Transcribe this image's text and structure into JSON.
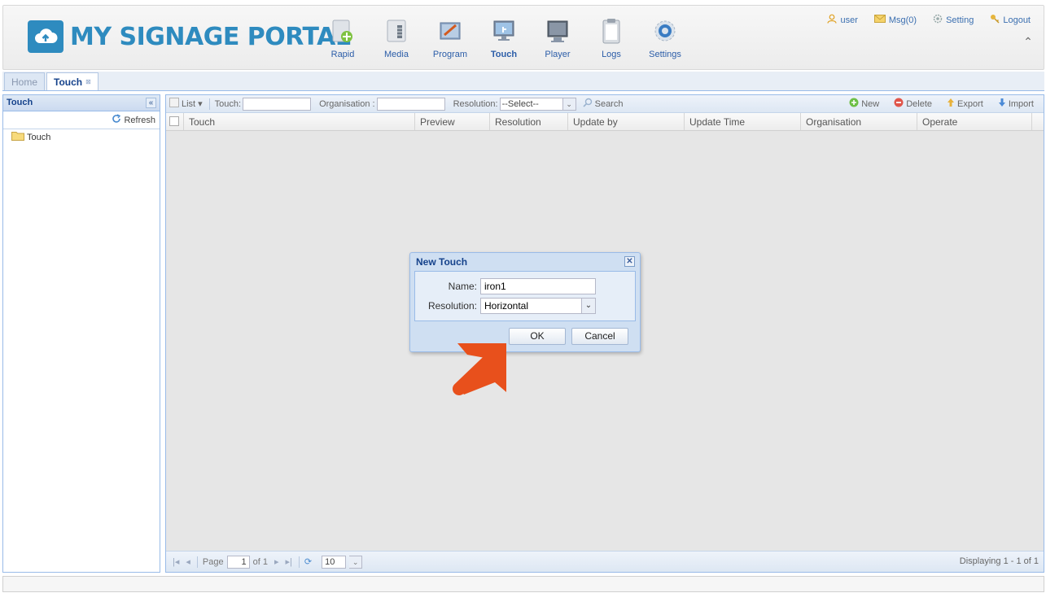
{
  "header": {
    "logo_text": "MY SIGNAGE PORTAL",
    "nav": [
      {
        "label": "Rapid",
        "icon": "rapid-icon"
      },
      {
        "label": "Media",
        "icon": "media-icon"
      },
      {
        "label": "Program",
        "icon": "program-icon"
      },
      {
        "label": "Touch",
        "icon": "touch-icon"
      },
      {
        "label": "Player",
        "icon": "player-icon"
      },
      {
        "label": "Logs",
        "icon": "logs-icon"
      },
      {
        "label": "Settings",
        "icon": "settings-icon"
      }
    ],
    "top_links": {
      "user": "user",
      "msg": "Msg(0)",
      "setting": "Setting",
      "logout": "Logout"
    }
  },
  "tabs": [
    {
      "label": "Home"
    },
    {
      "label": "Touch",
      "active": true
    }
  ],
  "left_panel": {
    "title": "Touch",
    "refresh_label": "Refresh",
    "tree": [
      "Touch"
    ]
  },
  "toolbar": {
    "list_label": "List",
    "touch_label": "Touch:",
    "organisation_label": "Organisation :",
    "resolution_label": "Resolution:",
    "resolution_value": "--Select--",
    "search_label": "Search",
    "new_label": "New",
    "delete_label": "Delete",
    "export_label": "Export",
    "import_label": "Import"
  },
  "grid": {
    "columns": [
      "Touch",
      "Preview",
      "Resolution",
      "Update by",
      "Update Time",
      "Organisation",
      "Operate"
    ],
    "rows": []
  },
  "paging": {
    "page_label": "Page",
    "page_value": "1",
    "of_label": "of 1",
    "page_size": "10",
    "display_text": "Displaying 1 - 1 of 1"
  },
  "dialog": {
    "title": "New Touch",
    "name_label": "Name:",
    "name_value": "iron1",
    "resolution_label": "Resolution:",
    "resolution_value": "Horizontal",
    "ok_label": "OK",
    "cancel_label": "Cancel"
  },
  "colors": {
    "brand": "#2e8bbf",
    "panel_border": "#99bbe8",
    "arrow": "#e8501c"
  }
}
